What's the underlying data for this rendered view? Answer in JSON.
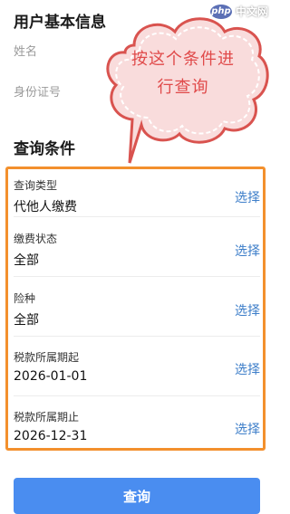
{
  "user_info": {
    "title": "用户基本信息",
    "name_label": "姓名",
    "id_label": "身份证号"
  },
  "callout": {
    "text": "按这个条件进行查询",
    "color": "#e04a4a"
  },
  "watermark": {
    "badge": "php",
    "text": "中文网"
  },
  "conditions": {
    "title": "查询条件",
    "highlight_color": "#f3902d",
    "items": [
      {
        "label": "查询类型",
        "value": "代他人缴费",
        "action": "选择"
      },
      {
        "label": "缴费状态",
        "value": "全部",
        "action": "选择"
      },
      {
        "label": "险种",
        "value": "全部",
        "action": "选择"
      },
      {
        "label": "税款所属期起",
        "value": "2026-01-01",
        "action": "选择"
      },
      {
        "label": "税款所属期止",
        "value": "2026-12-31",
        "action": "选择"
      }
    ]
  },
  "actions": {
    "query_label": "查询",
    "button_color": "#4a8df0"
  }
}
